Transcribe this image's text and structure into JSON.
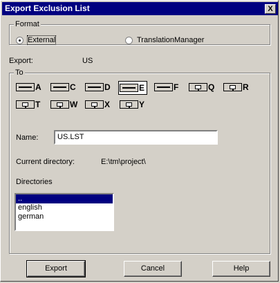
{
  "window": {
    "title": "Export Exclusion List",
    "close_glyph": "X"
  },
  "format": {
    "label": "Format",
    "options": [
      {
        "label": "External",
        "checked": true
      },
      {
        "label": "TranslationManager",
        "checked": false
      }
    ]
  },
  "export": {
    "label": "Export:",
    "value": "US"
  },
  "to": {
    "label": "To",
    "drives": [
      {
        "letter": "A",
        "type": "floppy",
        "selected": false
      },
      {
        "letter": "C",
        "type": "hard",
        "selected": false
      },
      {
        "letter": "D",
        "type": "hard",
        "selected": false
      },
      {
        "letter": "E",
        "type": "hard",
        "selected": true
      },
      {
        "letter": "F",
        "type": "removable",
        "selected": false
      },
      {
        "letter": "Q",
        "type": "network",
        "selected": false
      },
      {
        "letter": "R",
        "type": "network",
        "selected": false
      },
      {
        "letter": "T",
        "type": "network",
        "selected": false
      },
      {
        "letter": "W",
        "type": "network",
        "selected": false
      },
      {
        "letter": "X",
        "type": "network",
        "selected": false
      },
      {
        "letter": "Y",
        "type": "network",
        "selected": false
      }
    ],
    "name_label": "Name:",
    "name_value": "US.LST",
    "current_directory_label": "Current directory:",
    "current_directory_value": "E:\\tm\\project\\",
    "directories_label": "Directories",
    "directories": [
      {
        "name": "..",
        "selected": true
      },
      {
        "name": "english",
        "selected": false
      },
      {
        "name": "german",
        "selected": false
      }
    ]
  },
  "buttons": {
    "export": "Export",
    "cancel": "Cancel",
    "help": "Help"
  },
  "colors": {
    "face": "#d4d0c8",
    "titlebar": "#000080",
    "selection": "#000080"
  }
}
